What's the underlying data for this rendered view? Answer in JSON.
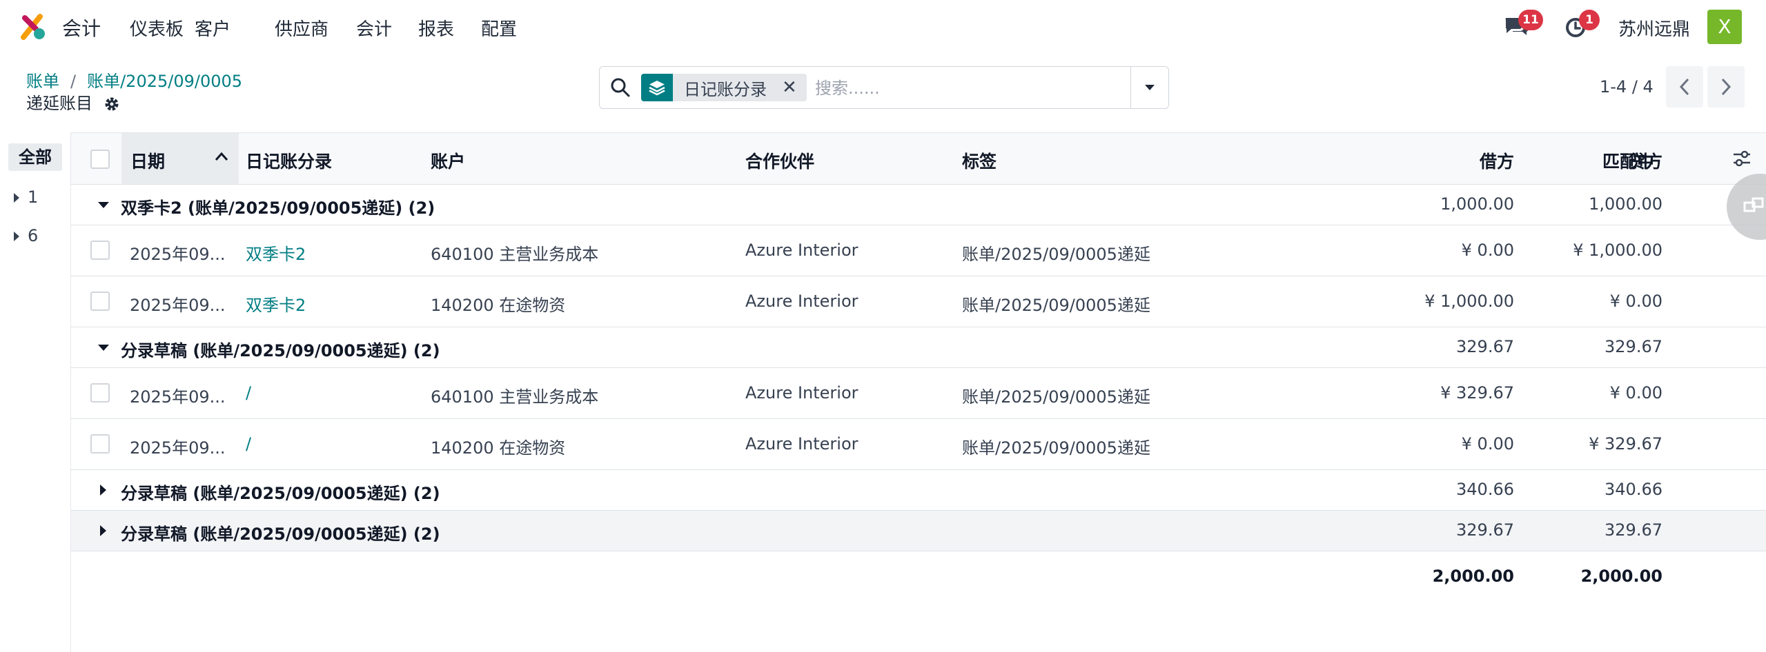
{
  "navbar": {
    "app_name": "会计",
    "menu": [
      "仪表板",
      "客户",
      "供应商",
      "会计",
      "报表",
      "配置"
    ],
    "messages_badge": "11",
    "activity_badge": "1",
    "company": "苏州远鼎",
    "avatar_letter": "X",
    "icons": {
      "messages": "chat-icon",
      "activity": "clock-icon"
    }
  },
  "breadcrumb": {
    "items": [
      "账单",
      "账单/2025/09/0005"
    ],
    "separator": "/",
    "current": "递延账目"
  },
  "search": {
    "facet_label": "日记账分录",
    "facet_remove": "✕",
    "placeholder": "搜索......",
    "value": ""
  },
  "pager": {
    "text": "1-4 / 4"
  },
  "side_panel": {
    "all_label": "全部",
    "items": [
      "1",
      "6"
    ]
  },
  "table": {
    "columns": {
      "date": "日期",
      "entry": "日记账分录",
      "account": "账户",
      "partner": "合作伙伴",
      "label": "标签",
      "debit": "借方",
      "credit": "贷方",
      "matching": "匹配中"
    },
    "groups": [
      {
        "title": "双季卡2 (账单/2025/09/0005递延) (2)",
        "debit": "1,000.00",
        "credit": "1,000.00",
        "expanded": true,
        "rows": [
          {
            "date": "2025年09...",
            "entry": "双季卡2",
            "account": "640100 主营业务成本",
            "partner": "Azure Interior",
            "label": "账单/2025/09/0005递延",
            "debit": "¥ 0.00",
            "credit": "¥ 1,000.00"
          },
          {
            "date": "2025年09...",
            "entry": "双季卡2",
            "account": "140200 在途物资",
            "partner": "Azure Interior",
            "label": "账单/2025/09/0005递延",
            "debit": "¥ 1,000.00",
            "credit": "¥ 0.00"
          }
        ]
      },
      {
        "title": "分录草稿 (账单/2025/09/0005递延) (2)",
        "debit": "329.67",
        "credit": "329.67",
        "expanded": true,
        "rows": [
          {
            "date": "2025年09...",
            "entry": "/",
            "account": "640100 主营业务成本",
            "partner": "Azure Interior",
            "label": "账单/2025/09/0005递延",
            "debit": "¥ 329.67",
            "credit": "¥ 0.00"
          },
          {
            "date": "2025年09...",
            "entry": "/",
            "account": "140200 在途物资",
            "partner": "Azure Interior",
            "label": "账单/2025/09/0005递延",
            "debit": "¥ 0.00",
            "credit": "¥ 329.67"
          }
        ]
      },
      {
        "title": "分录草稿 (账单/2025/09/0005递延) (2)",
        "debit": "340.66",
        "credit": "340.66",
        "expanded": false,
        "rows": []
      },
      {
        "title": "分录草稿 (账单/2025/09/0005递延) (2)",
        "debit": "329.67",
        "credit": "329.67",
        "expanded": false,
        "rows": []
      }
    ],
    "totals": {
      "debit": "2,000.00",
      "credit": "2,000.00"
    }
  },
  "colors": {
    "accent": "#017e84",
    "badge": "#dc3545",
    "avatar": "#76b82a"
  }
}
